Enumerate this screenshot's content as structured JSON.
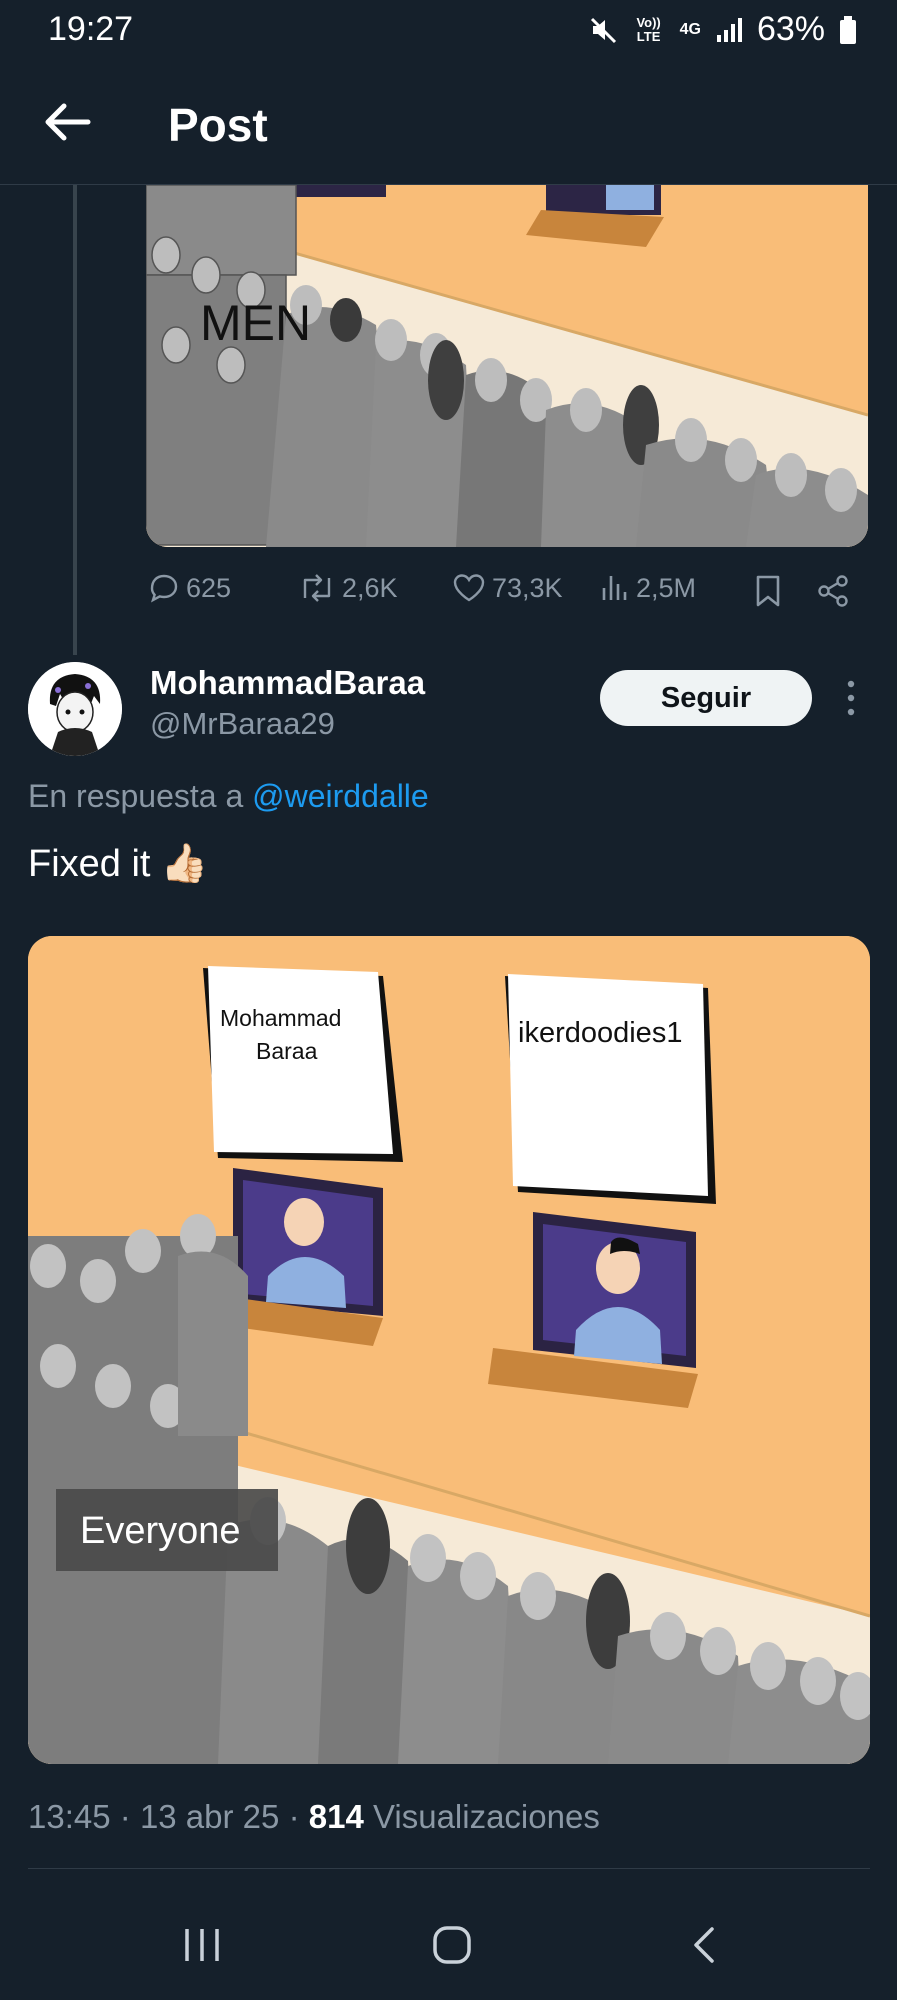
{
  "status_bar": {
    "time": "19:27",
    "network_top": "Vo)) LTE",
    "network_gen": "4G",
    "battery": "63%"
  },
  "header": {
    "title": "Post"
  },
  "original_post": {
    "image_caption": "MEN",
    "actions": {
      "replies": "625",
      "reposts": "2,6K",
      "likes": "73,3K",
      "views": "2,5M"
    }
  },
  "reply": {
    "display_name": "MohammadBaraa",
    "handle": "@MrBaraa29",
    "follow_label": "Seguir",
    "reply_prefix": "En respuesta a",
    "reply_mention": "@weirddalle",
    "text": "Fixed it",
    "emoji": "👍🏻",
    "meme": {
      "sign_left": "Mohammad\nBaraa",
      "sign_right": "ikerdoodies1",
      "crowd_label": "Everyone"
    },
    "meta": {
      "time": "13:45",
      "date": "13 abr 25",
      "views_count": "814",
      "views_label": "Visualizaciones"
    }
  },
  "colors": {
    "background": "#15202b",
    "accent": "#1d9bf0",
    "muted": "#8b98a5",
    "wall": "#f9bd78"
  }
}
